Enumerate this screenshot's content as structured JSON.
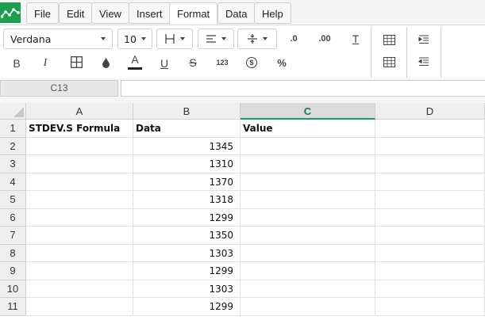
{
  "menubar": {
    "items": [
      "File",
      "Edit",
      "View",
      "Insert",
      "Format",
      "Data",
      "Help"
    ],
    "active": "Format"
  },
  "toolbar": {
    "font_name": "Verdana",
    "font_size": "10",
    "number_format_label": "123",
    "currency_icon_label": "$",
    "percent_label": "%",
    "decrease_decimal_label": ".0",
    "increase_decimal_label": ".00",
    "bold_label": "B",
    "italic_label": "I",
    "underline_label": "U",
    "strike_label": "S",
    "text_color_label": "A",
    "clear_format_label": "T"
  },
  "formula_bar": {
    "cell_ref": "C13",
    "value": ""
  },
  "sheet": {
    "columns": [
      "A",
      "B",
      "C",
      "D"
    ],
    "selected_column": "C",
    "rows": [
      {
        "n": "1",
        "a": "STDEV.S Formula",
        "b": "Data",
        "c": "Value",
        "d": ""
      },
      {
        "n": "2",
        "a": "",
        "b": "1345",
        "c": "",
        "d": ""
      },
      {
        "n": "3",
        "a": "",
        "b": "1310",
        "c": "",
        "d": ""
      },
      {
        "n": "4",
        "a": "",
        "b": "1370",
        "c": "",
        "d": ""
      },
      {
        "n": "5",
        "a": "",
        "b": "1318",
        "c": "",
        "d": ""
      },
      {
        "n": "6",
        "a": "",
        "b": "1299",
        "c": "",
        "d": ""
      },
      {
        "n": "7",
        "a": "",
        "b": "1350",
        "c": "",
        "d": ""
      },
      {
        "n": "8",
        "a": "",
        "b": "1303",
        "c": "",
        "d": ""
      },
      {
        "n": "9",
        "a": "",
        "b": "1299",
        "c": "",
        "d": ""
      },
      {
        "n": "10",
        "a": "",
        "b": "1303",
        "c": "",
        "d": ""
      },
      {
        "n": "11",
        "a": "",
        "b": "1299",
        "c": "",
        "d": ""
      }
    ]
  },
  "colors": {
    "accent": "#1a9c6a",
    "logo": "#1e9e4f",
    "text_color_underline": "#222222"
  }
}
